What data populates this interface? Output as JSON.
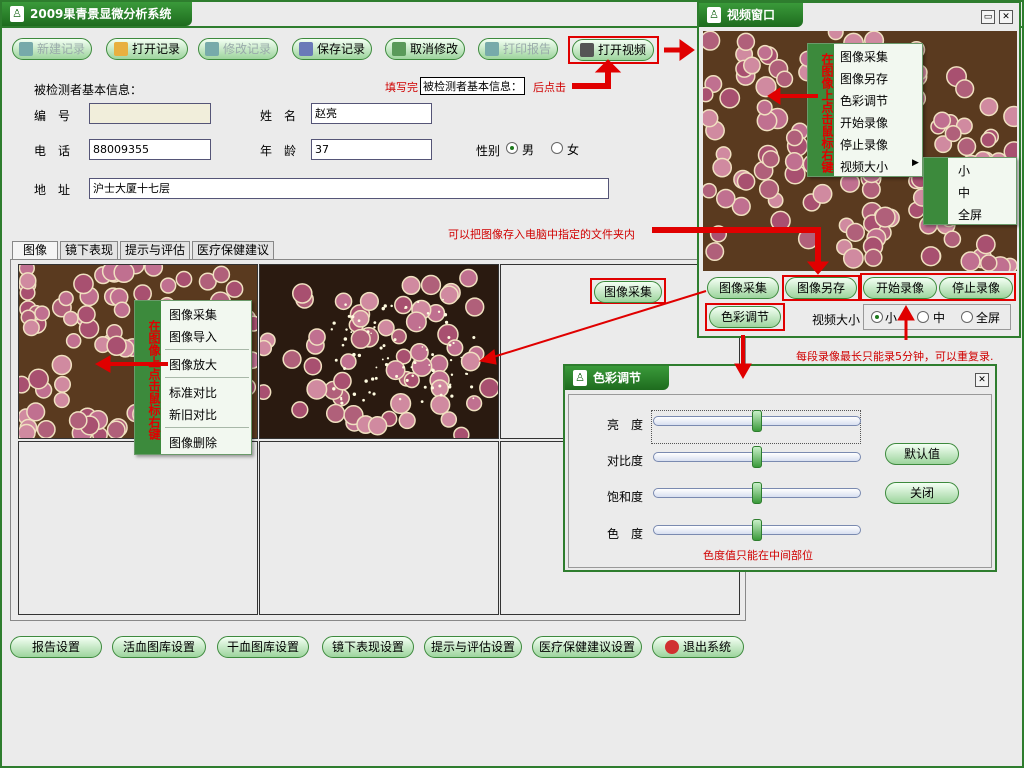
{
  "app": {
    "title": "2009果青景显微分析系统"
  },
  "toolbar": {
    "new_record": "新建记录",
    "open_record": "打开记录",
    "edit_record": "修改记录",
    "save_record": "保存记录",
    "cancel_edit": "取消修改",
    "print_report": "打印报告",
    "open_video": "打开视频"
  },
  "patient": {
    "section_title": "被检测者基本信息：",
    "id_label": "编　号",
    "id_value": "",
    "name_label": "姓　名",
    "name_value": "赵亮",
    "phone_label": "电　话",
    "phone_value": "88009355",
    "age_label": "年　龄",
    "age_value": "37",
    "gender_label": "性别",
    "gender_male": "男",
    "gender_female": "女",
    "gender_selected": "男",
    "address_label": "地　址",
    "address_value": "沪士大厦十七层"
  },
  "annotations": {
    "fill_prefix": "填写完",
    "fill_box": "被检测者基本信息：",
    "fill_suffix": "后点击",
    "save_to_folder": "可以把图像存入电脑中指定的文件夹内",
    "click": "点击",
    "record_limit": "每段录像最长只能录5分钟，可以重复录.",
    "hue_note": "色度值只能在中间部位"
  },
  "tabs": [
    "图像",
    "镜下表现",
    "提示与评估",
    "医疗保健建议"
  ],
  "image_panel": {
    "capture_button": "图像采集"
  },
  "image_menu": {
    "side_label": "在图像上点击鼠标右键",
    "items": [
      "图像采集",
      "图像导入",
      "图像放大",
      "标准对比",
      "新旧对比",
      "图像删除"
    ]
  },
  "bottom_bar": [
    "报告设置",
    "活血图库设置",
    "干血图库设置",
    "镜下表现设置",
    "提示与评估设置",
    "医疗保健建议设置",
    "退出系统"
  ],
  "video_window": {
    "title": "视频窗口",
    "menu_side_label": "在图像上点击鼠标右键",
    "menu_items": [
      "图像采集",
      "图像另存",
      "色彩调节",
      "开始录像",
      "停止录像",
      "视频大小"
    ],
    "submenu_items": [
      "小",
      "中",
      "全屏"
    ],
    "capture": "图像采集",
    "save_as": "图像另存",
    "start_record": "开始录像",
    "stop_record": "停止录像",
    "color_adjust": "色彩调节",
    "size_label": "视频大小",
    "size_options": [
      "小",
      "中",
      "全屏"
    ],
    "size_selected": "小"
  },
  "color_window": {
    "title": "色彩调节",
    "brightness": "亮　度",
    "contrast": "对比度",
    "saturation": "饱和度",
    "hue": "色　度",
    "default_button": "默认值",
    "close_button": "关闭",
    "slider_levels": {
      "brightness": 0.5,
      "contrast": 0.5,
      "saturation": 0.5,
      "hue": 0.5
    }
  },
  "colors": {
    "accent": "#2e7d2e",
    "alert": "#e00000",
    "title_gradient_top": "#3a9a3a"
  }
}
